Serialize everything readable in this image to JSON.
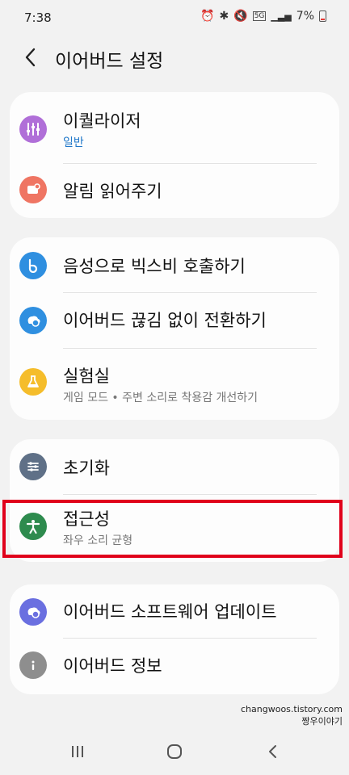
{
  "status_bar": {
    "time": "7:38",
    "battery": "7%",
    "network": "5G"
  },
  "header": {
    "title": "이어버드 설정"
  },
  "groups": [
    {
      "items": [
        {
          "label": "이퀄라이저",
          "sub": "일반",
          "icon": "equalizer-icon",
          "color": "#b06fd8"
        },
        {
          "label": "알림 읽어주기",
          "icon": "notification-icon",
          "color": "#ef7563"
        }
      ]
    },
    {
      "items": [
        {
          "label": "음성으로 빅스비 호출하기",
          "icon": "bixby-icon",
          "color": "#2f8fe0"
        },
        {
          "label": "이어버드 끊김 없이 전환하기",
          "icon": "seamless-switch-icon",
          "color": "#2f8fe0"
        },
        {
          "label": "실험실",
          "sub": "게임 모드  •  주변 소리로 착용감 개선하기",
          "icon": "lab-flask-icon",
          "color": "#f5bd2b"
        }
      ]
    },
    {
      "items": [
        {
          "label": "초기화",
          "icon": "reset-sliders-icon",
          "color": "#5f7087"
        },
        {
          "label": "접근성",
          "sub": "좌우 소리 균형",
          "icon": "accessibility-icon",
          "color": "#2e8b4e"
        }
      ]
    },
    {
      "items": [
        {
          "label": "이어버드 소프트웨어 업데이트",
          "icon": "software-update-icon",
          "color": "#6a6fe0"
        },
        {
          "label": "이어버드 정보",
          "icon": "info-icon",
          "color": "#8e8e8e"
        }
      ]
    }
  ],
  "watermark": {
    "line1": "changwoos.tistory.com",
    "line2": "짱우이야기"
  }
}
